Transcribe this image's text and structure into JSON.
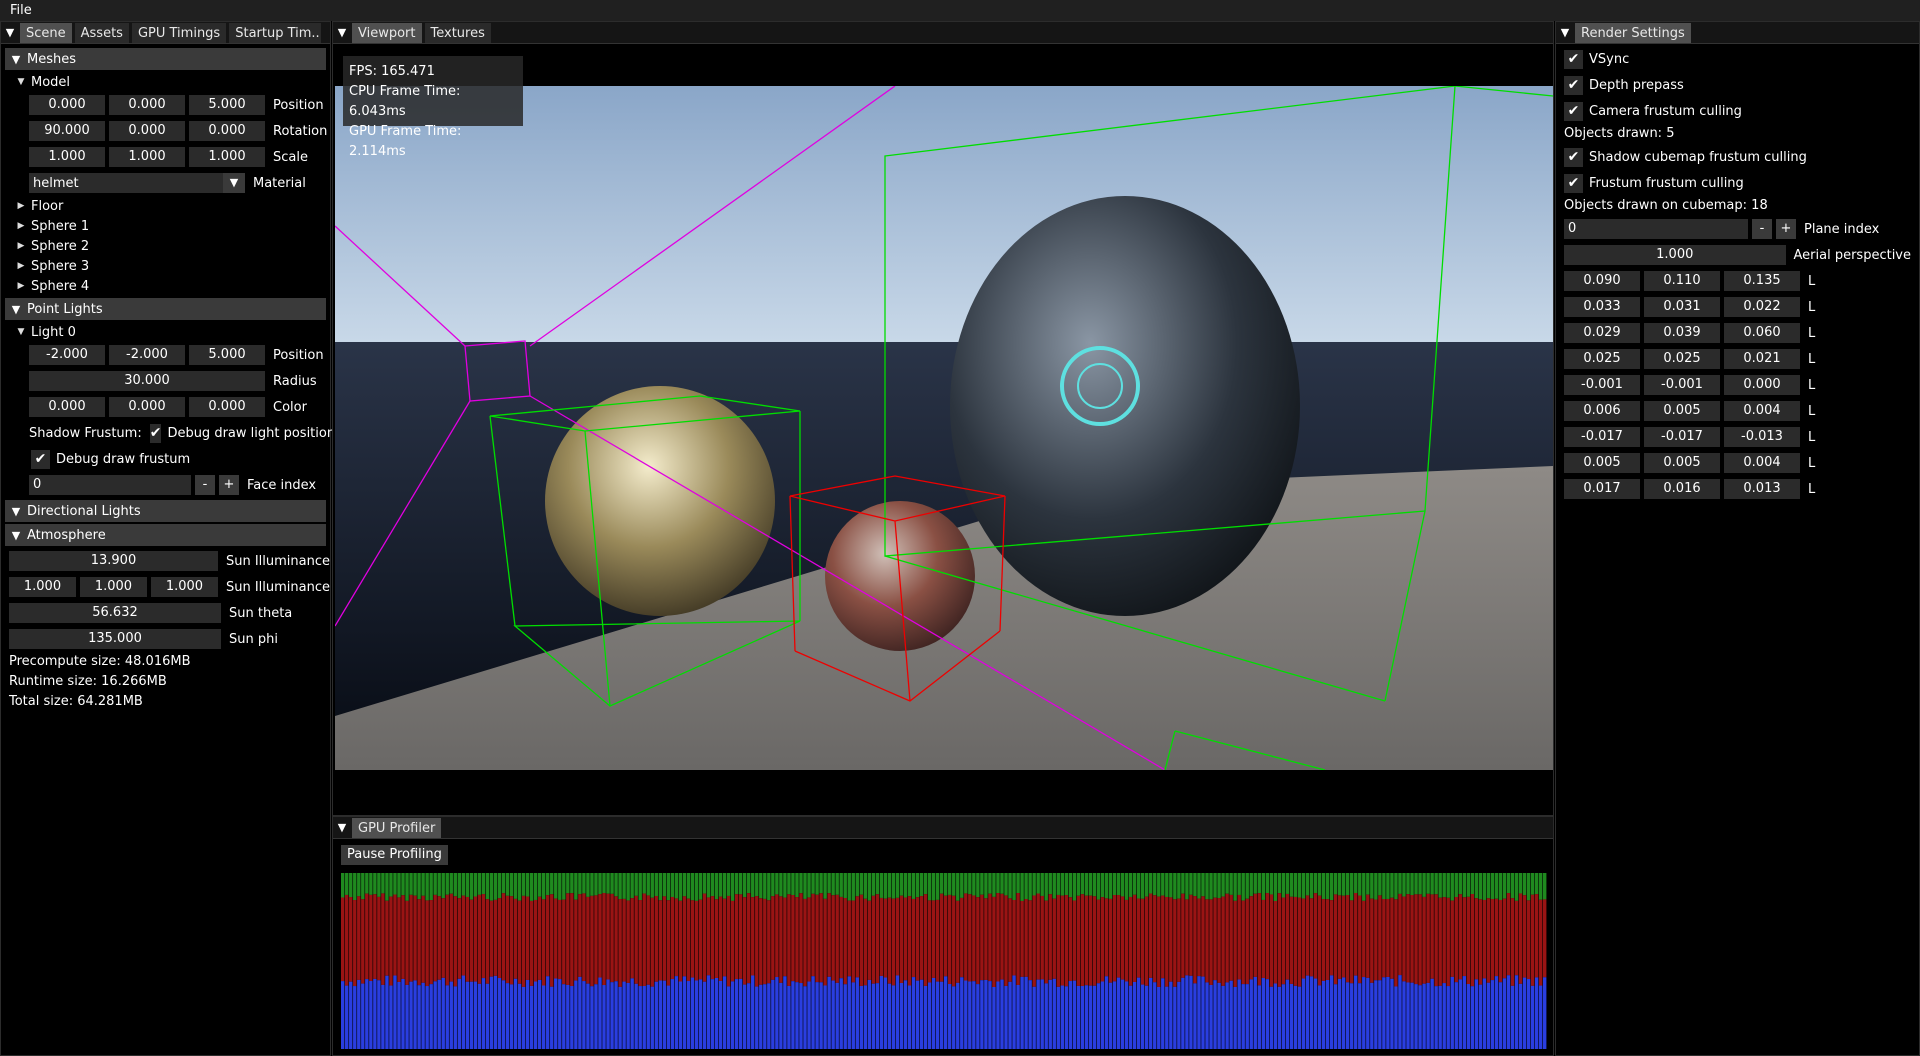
{
  "menu": {
    "file": "File"
  },
  "left_panel": {
    "tabs": [
      "Scene",
      "Assets",
      "GPU Timings",
      "Startup Tim..."
    ],
    "meshes": {
      "header": "Meshes",
      "model": {
        "label": "Model",
        "position": {
          "values": [
            "0.000",
            "0.000",
            "5.000"
          ],
          "label": "Position"
        },
        "rotation": {
          "values": [
            "90.000",
            "0.000",
            "0.000"
          ],
          "label": "Rotation"
        },
        "scale": {
          "values": [
            "1.000",
            "1.000",
            "1.000"
          ],
          "label": "Scale"
        },
        "material": {
          "value": "helmet",
          "label": "Material"
        }
      },
      "items": [
        "Floor",
        "Sphere 1",
        "Sphere 2",
        "Sphere 3",
        "Sphere 4"
      ]
    },
    "point_lights": {
      "header": "Point Lights",
      "light0": {
        "label": "Light 0",
        "position": {
          "values": [
            "-2.000",
            "-2.000",
            "5.000"
          ],
          "label": "Position"
        },
        "radius": {
          "value": "30.000",
          "label": "Radius"
        },
        "color": {
          "values": [
            "0.000",
            "0.000",
            "0.000"
          ],
          "label": "Color"
        },
        "shadow_frustum": "Shadow Frustum:",
        "debug_light_position": "Debug draw light position",
        "debug_frustum": "Debug draw frustum",
        "face_index": {
          "value": "0",
          "label": "Face index",
          "minus": "-",
          "plus": "+"
        }
      }
    },
    "directional_lights": {
      "header": "Directional Lights"
    },
    "atmosphere": {
      "header": "Atmosphere",
      "sun_illuminance_1": {
        "value": "13.900",
        "label": "Sun Illuminance"
      },
      "sun_illuminance_2": {
        "values": [
          "1.000",
          "1.000",
          "1.000"
        ],
        "label": "Sun Illuminance"
      },
      "sun_theta": {
        "value": "56.632",
        "label": "Sun theta"
      },
      "sun_phi": {
        "value": "135.000",
        "label": "Sun phi"
      },
      "precompute": "Precompute size: 48.016MB",
      "runtime": "Runtime size: 16.266MB",
      "total": "Total size: 64.281MB"
    }
  },
  "viewport": {
    "tabs": [
      "Viewport",
      "Textures"
    ],
    "fps": "FPS: 165.471",
    "cpu": "CPU Frame Time: 6.043ms",
    "gpu": "GPU Frame Time: 2.114ms"
  },
  "profiler": {
    "tab": "GPU Profiler",
    "pause": "Pause Profiling",
    "colors": {
      "green": "#1f8a1f",
      "red": "#9a1414",
      "blue": "#2a3ee0"
    }
  },
  "render_settings": {
    "tab": "Render Settings",
    "vsync": "VSync",
    "depth_prepass": "Depth prepass",
    "camera_culling": "Camera frustum culling",
    "objects_drawn": "Objects drawn: 5",
    "shadow_culling": "Shadow cubemap frustum culling",
    "frustum_culling": "Frustum frustum culling",
    "objects_cubemap": "Objects drawn on cubemap: 18",
    "plane_index": {
      "value": "0",
      "label": "Plane index",
      "minus": "-",
      "plus": "+"
    },
    "aerial": {
      "value": "1.000",
      "label": "Aerial perspective"
    },
    "l_rows": [
      [
        "0.090",
        "0.110",
        "0.135"
      ],
      [
        "0.033",
        "0.031",
        "0.022"
      ],
      [
        "0.029",
        "0.039",
        "0.060"
      ],
      [
        "0.025",
        "0.025",
        "0.021"
      ],
      [
        "-0.001",
        "-0.001",
        "0.000"
      ],
      [
        "0.006",
        "0.005",
        "0.004"
      ],
      [
        "-0.017",
        "-0.017",
        "-0.013"
      ],
      [
        "0.005",
        "0.005",
        "0.004"
      ],
      [
        "0.017",
        "0.016",
        "0.013"
      ]
    ],
    "l_label": "L"
  }
}
